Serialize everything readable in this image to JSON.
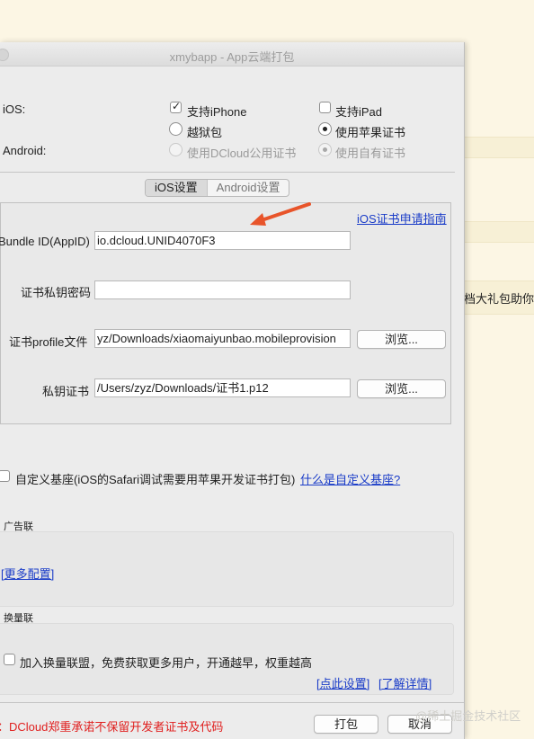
{
  "window": {
    "title": "xmybapp - App云端打包"
  },
  "background": {
    "snippet": "档大礼包助你"
  },
  "platforms": {
    "ios_label": "iOS:",
    "android_label": "Android:",
    "iphone": {
      "label": "支持iPhone",
      "checked": true
    },
    "ipad": {
      "label": "支持iPad",
      "checked": false
    },
    "jailbreak": {
      "label": "越狱包",
      "selected": false
    },
    "apple_cert": {
      "label": "使用苹果证书",
      "selected": true
    },
    "dcloud_cert": {
      "label": "使用DCloud公用证书",
      "selected": false,
      "enabled": false
    },
    "own_cert": {
      "label": "使用自有证书",
      "selected": true,
      "enabled": false
    }
  },
  "tabs": [
    {
      "label": "iOS设置",
      "active": true
    },
    {
      "label": "Android设置",
      "active": false
    }
  ],
  "ios_settings": {
    "guide_link": "iOS证书申请指南",
    "bundle_id": {
      "label": "Bundle ID(AppID)",
      "value": "io.dcloud.UNID4070F3"
    },
    "key_password": {
      "label": "证书私钥密码",
      "value": ""
    },
    "profile": {
      "label": "证书profile文件",
      "value": "yz/Downloads/xiaomaiyunbao.mobileprovision",
      "browse": "浏览..."
    },
    "private_key": {
      "label": "私钥证书",
      "value": "/Users/zyz/Downloads/证书1.p12",
      "browse": "浏览..."
    }
  },
  "custom_base": {
    "label": "自定义基座(iOS的Safari调试需要用苹果开发证书打包)",
    "link": "什么是自定义基座?",
    "checked": false
  },
  "ad_union": {
    "title": "广告联盟",
    "more_link": "[更多配置]"
  },
  "traffic_union": {
    "title": "换量联盟",
    "checkbox_label": "加入换量联盟，免费获取更多用户，开通越早，权重越高",
    "checked": false,
    "settings_link": "[点此设置]",
    "details_link": "[了解详情]"
  },
  "footer": {
    "notice": "：DCloud郑重承诺不保留开发者证书及代码",
    "pack_button": "打包",
    "cancel_button": "取消"
  },
  "watermark": "@稀土掘金技术社区",
  "colors": {
    "link": "#1a3cc8",
    "notice": "#e0201f",
    "arrow": "#e8542a"
  }
}
